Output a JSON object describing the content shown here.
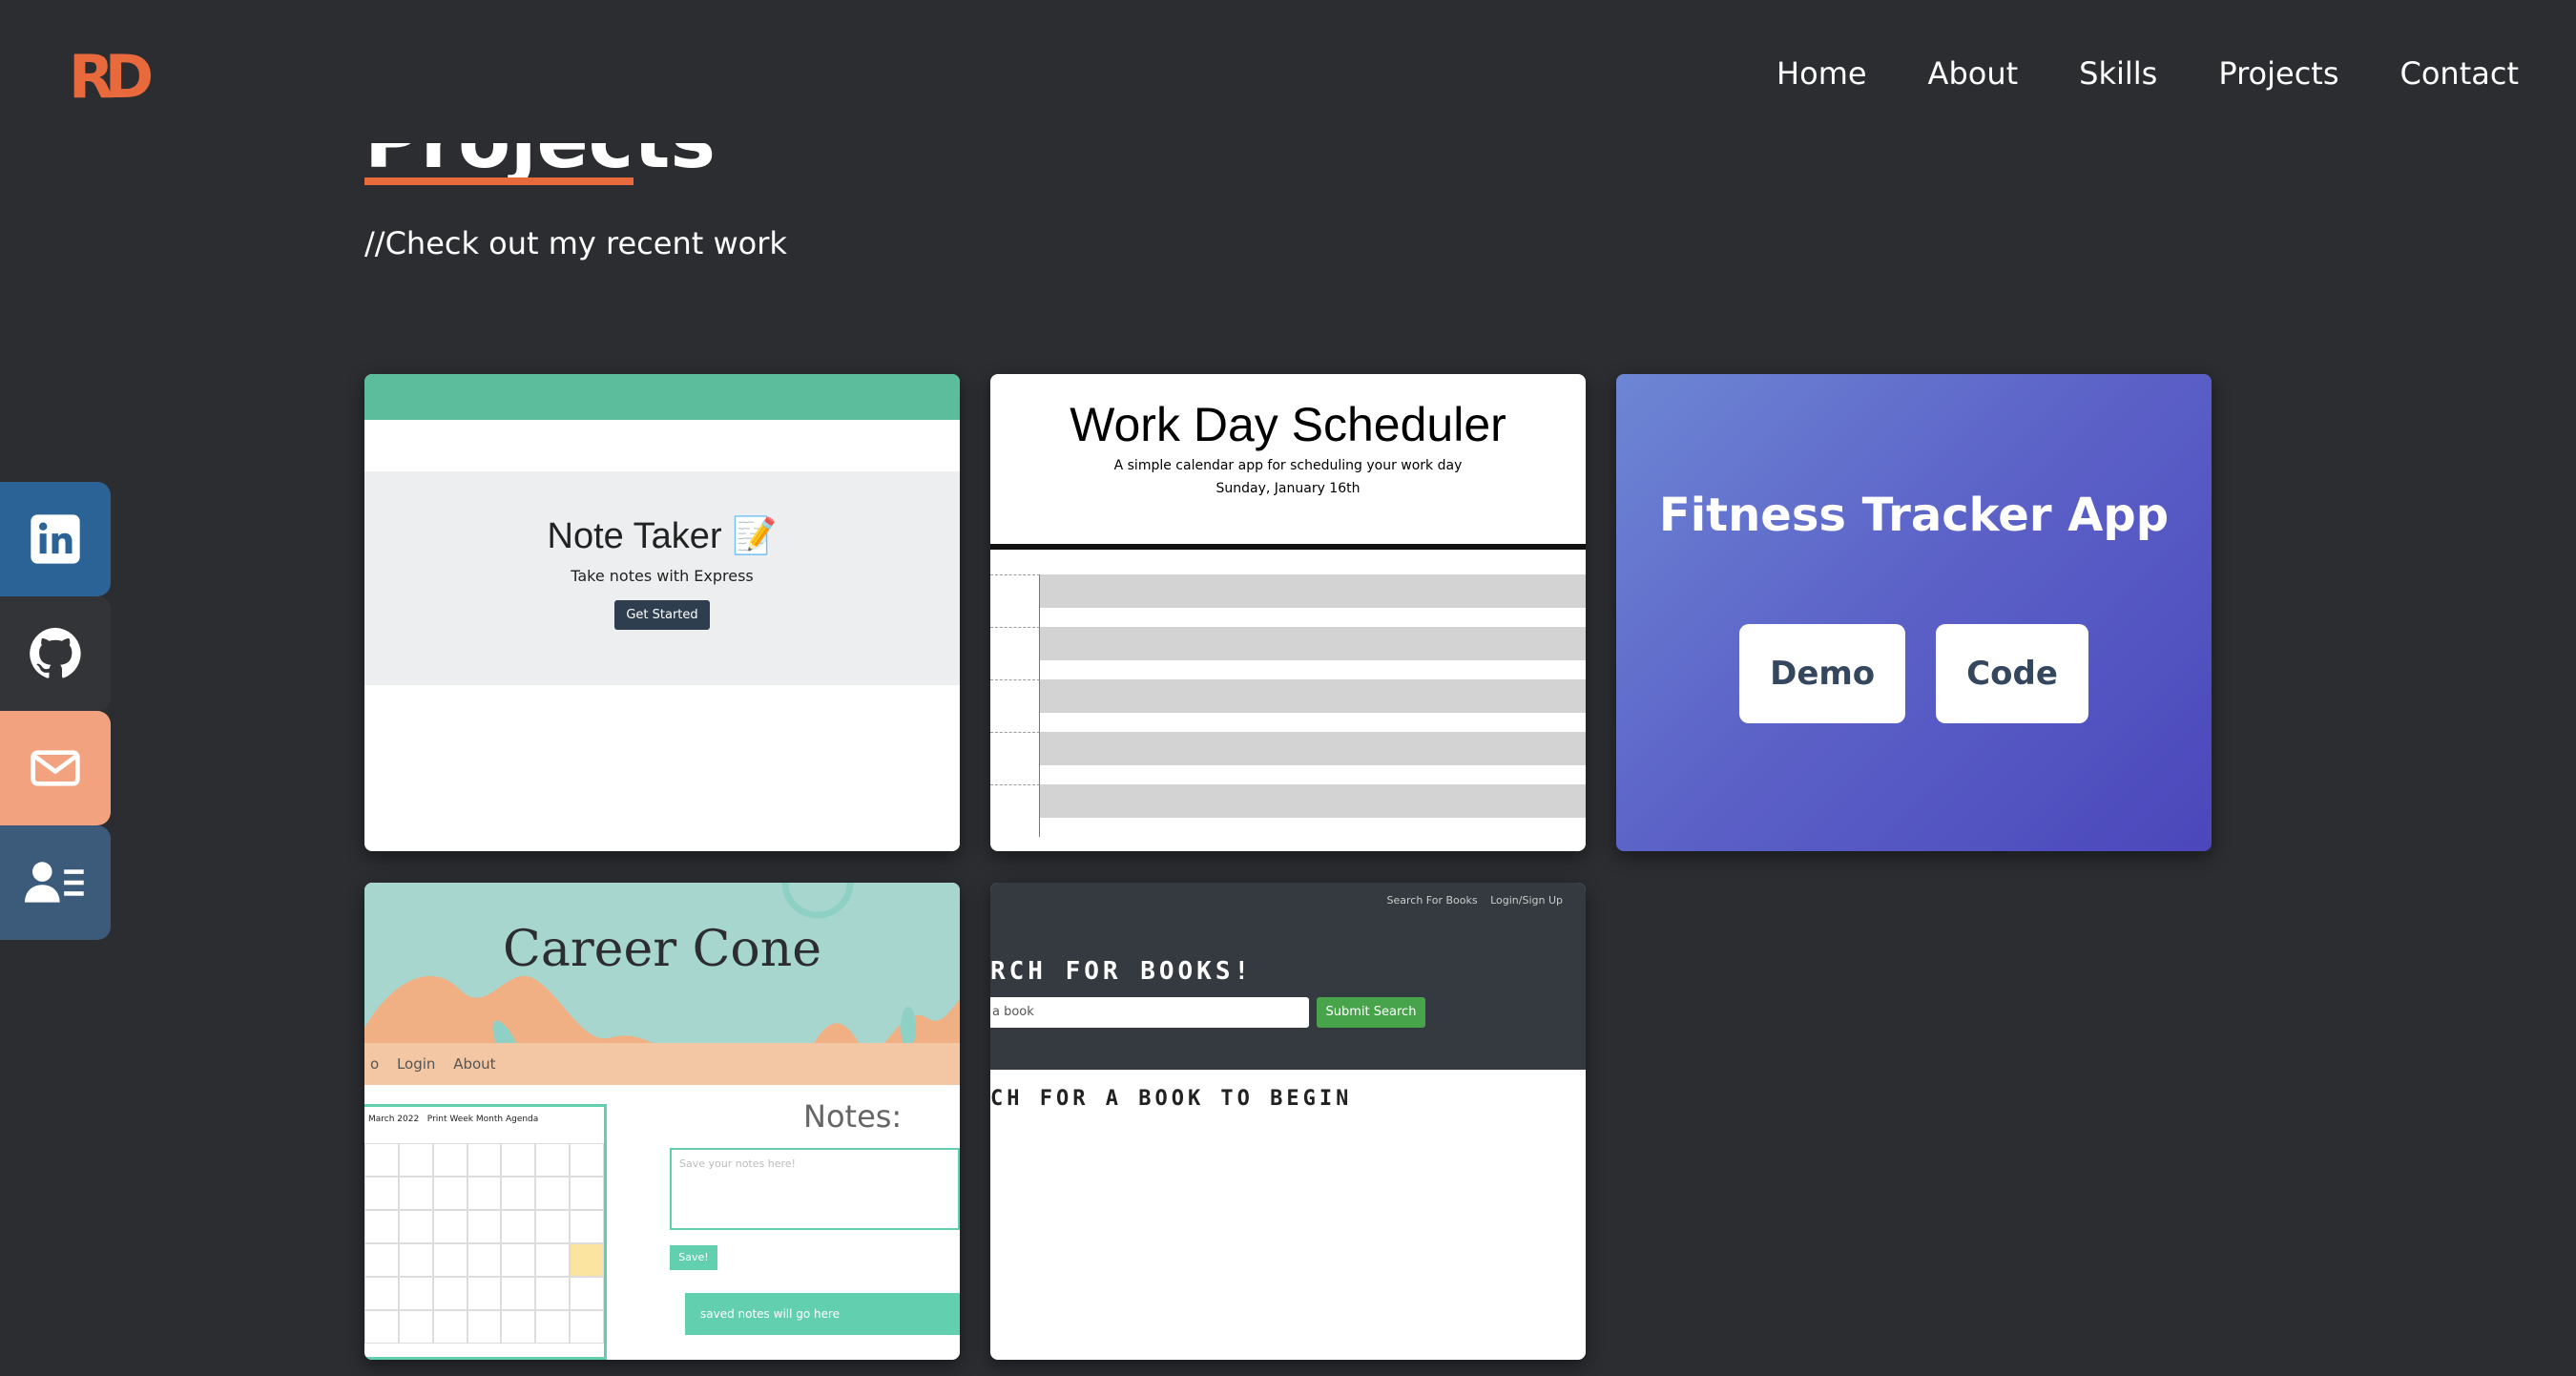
{
  "header": {
    "logo": "RD",
    "nav": [
      {
        "label": "Home"
      },
      {
        "label": "About"
      },
      {
        "label": "Skills"
      },
      {
        "label": "Projects"
      },
      {
        "label": "Contact"
      }
    ]
  },
  "section": {
    "title": "Projects",
    "subtitle": "//Check out my recent work"
  },
  "social": [
    {
      "icon": "linkedin-icon",
      "color": "#2c6396"
    },
    {
      "icon": "github-icon",
      "color": "#333438"
    },
    {
      "icon": "mail-icon",
      "color": "#f2a27f"
    },
    {
      "icon": "resume-icon",
      "color": "#3c5a79"
    }
  ],
  "projects": {
    "note_taker": {
      "title": "Note Taker 📝",
      "subtitle": "Take notes with Express",
      "button": "Get Started"
    },
    "work_day": {
      "title": "Work Day Scheduler",
      "subtitle": "A simple calendar app for scheduling your work day",
      "date": "Sunday, January 16th"
    },
    "fitness": {
      "title": "Fitness Tracker App",
      "demo": "Demo",
      "code": "Code"
    },
    "career_cone": {
      "title": "Career Cone",
      "nav": [
        "o",
        "Login",
        "About"
      ],
      "calendar_month": "March 2022",
      "calendar_views": "Print  Week  Month  Agenda",
      "notes_title": "Notes:",
      "notes_placeholder": "Save your notes here!",
      "save": "Save!",
      "saved": "saved notes will go here"
    },
    "books": {
      "nav": [
        "Search For Books",
        "Login/Sign Up"
      ],
      "title": "RCH FOR BOOKS!",
      "input": "a book",
      "button": "Submit Search",
      "message": "CH FOR A BOOK TO BEGIN"
    }
  },
  "colors": {
    "background": "#2b2d31",
    "accent": "#e8693c"
  }
}
